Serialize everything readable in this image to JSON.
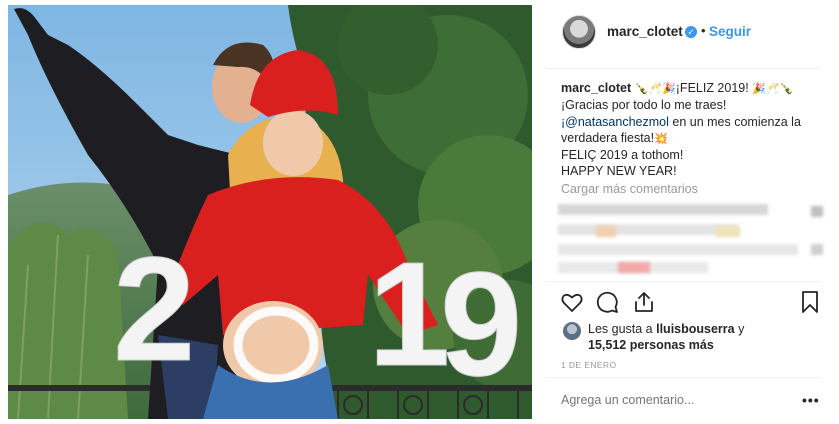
{
  "post": {
    "author": {
      "username": "marc_clotet",
      "verified": true,
      "follow_label": "Seguir"
    },
    "photo": {
      "numbers": [
        "2",
        "1",
        "9"
      ]
    },
    "caption": {
      "username": "marc_clotet",
      "line1_emoji_a": "🍾🥂🎉",
      "line1_text": "¡FELIZ 2019!",
      "line1_emoji_b": "🎉🥂🍾",
      "line2": "¡Gracias por todo lo me traes!",
      "line3_mention": "¡@natasanchezmol",
      "line3_rest": " en un mes comienza la",
      "line4_text": "verdadera fiesta!",
      "line4_emoji": "💥",
      "line5": "FELIÇ 2019 a tothom!",
      "line6": "HAPPY NEW YEAR!"
    },
    "load_more_label": "Cargar más comentarios",
    "actions": {
      "like_icon": "heart-icon",
      "comment_icon": "comment-icon",
      "share_icon": "share-icon",
      "save_icon": "bookmark-icon"
    },
    "likes": {
      "prefix": "Les gusta a ",
      "user": "lluisbouserra",
      "suffix": " y",
      "count_text": "15,512 personas más"
    },
    "date": "1 DE ENERO",
    "comment_placeholder": "Agrega un comentario...",
    "more_options": "•••",
    "colors": {
      "link_blue": "#3897f0",
      "mention": "#003569",
      "muted": "#999999",
      "hat_red": "#d9201e"
    }
  }
}
